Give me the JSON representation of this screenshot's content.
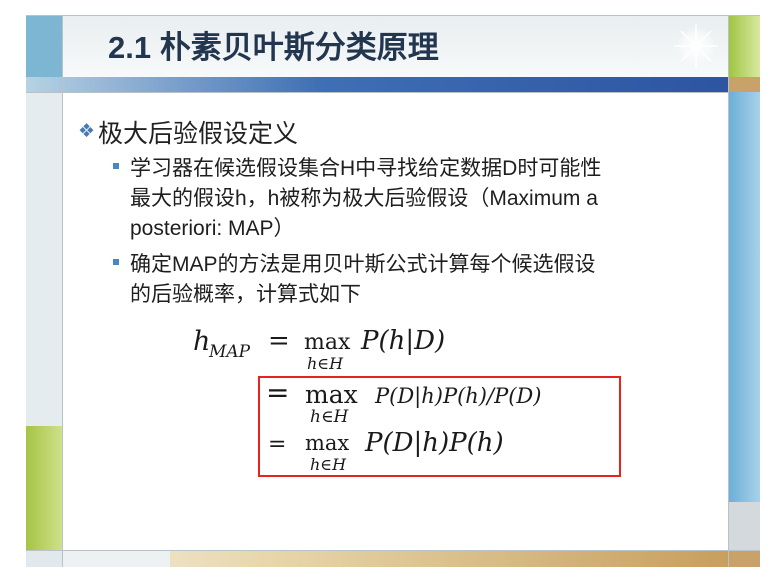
{
  "title": "2.1 朴素贝叶斯分类原理",
  "heading": "极大后验假设定义",
  "bullets": [
    {
      "lines": [
        "学习器在候选假设集合H中寻找给定数据D时可能性",
        "最大的假设h，h被称为极大后验假设（Maximum a",
        "posteriori: MAP）"
      ]
    },
    {
      "lines": [
        "确定MAP的方法是用贝叶斯公式计算每个候选假设",
        "的后验概率，计算式如下"
      ]
    }
  ],
  "formula": {
    "lhs": "h",
    "lhs_sub": "MAP",
    "eq": "=",
    "max": "max",
    "max_sub": "h∈H",
    "line1_rhs": "P(h|D)",
    "line2_rhs": "P(D|h)P(h)/P(D)",
    "line3_rhs": "P(D|h)P(h)"
  },
  "colors": {
    "title_text": "#22374f",
    "accent_blue": "#3f6fb4",
    "accent_green": "#a6c445",
    "highlight_box": "#e8231e",
    "bullet": "#4b86c7"
  },
  "icons": {
    "heading_marker": "diamond-cluster-icon",
    "title_decoration": "sparkle-icon"
  }
}
